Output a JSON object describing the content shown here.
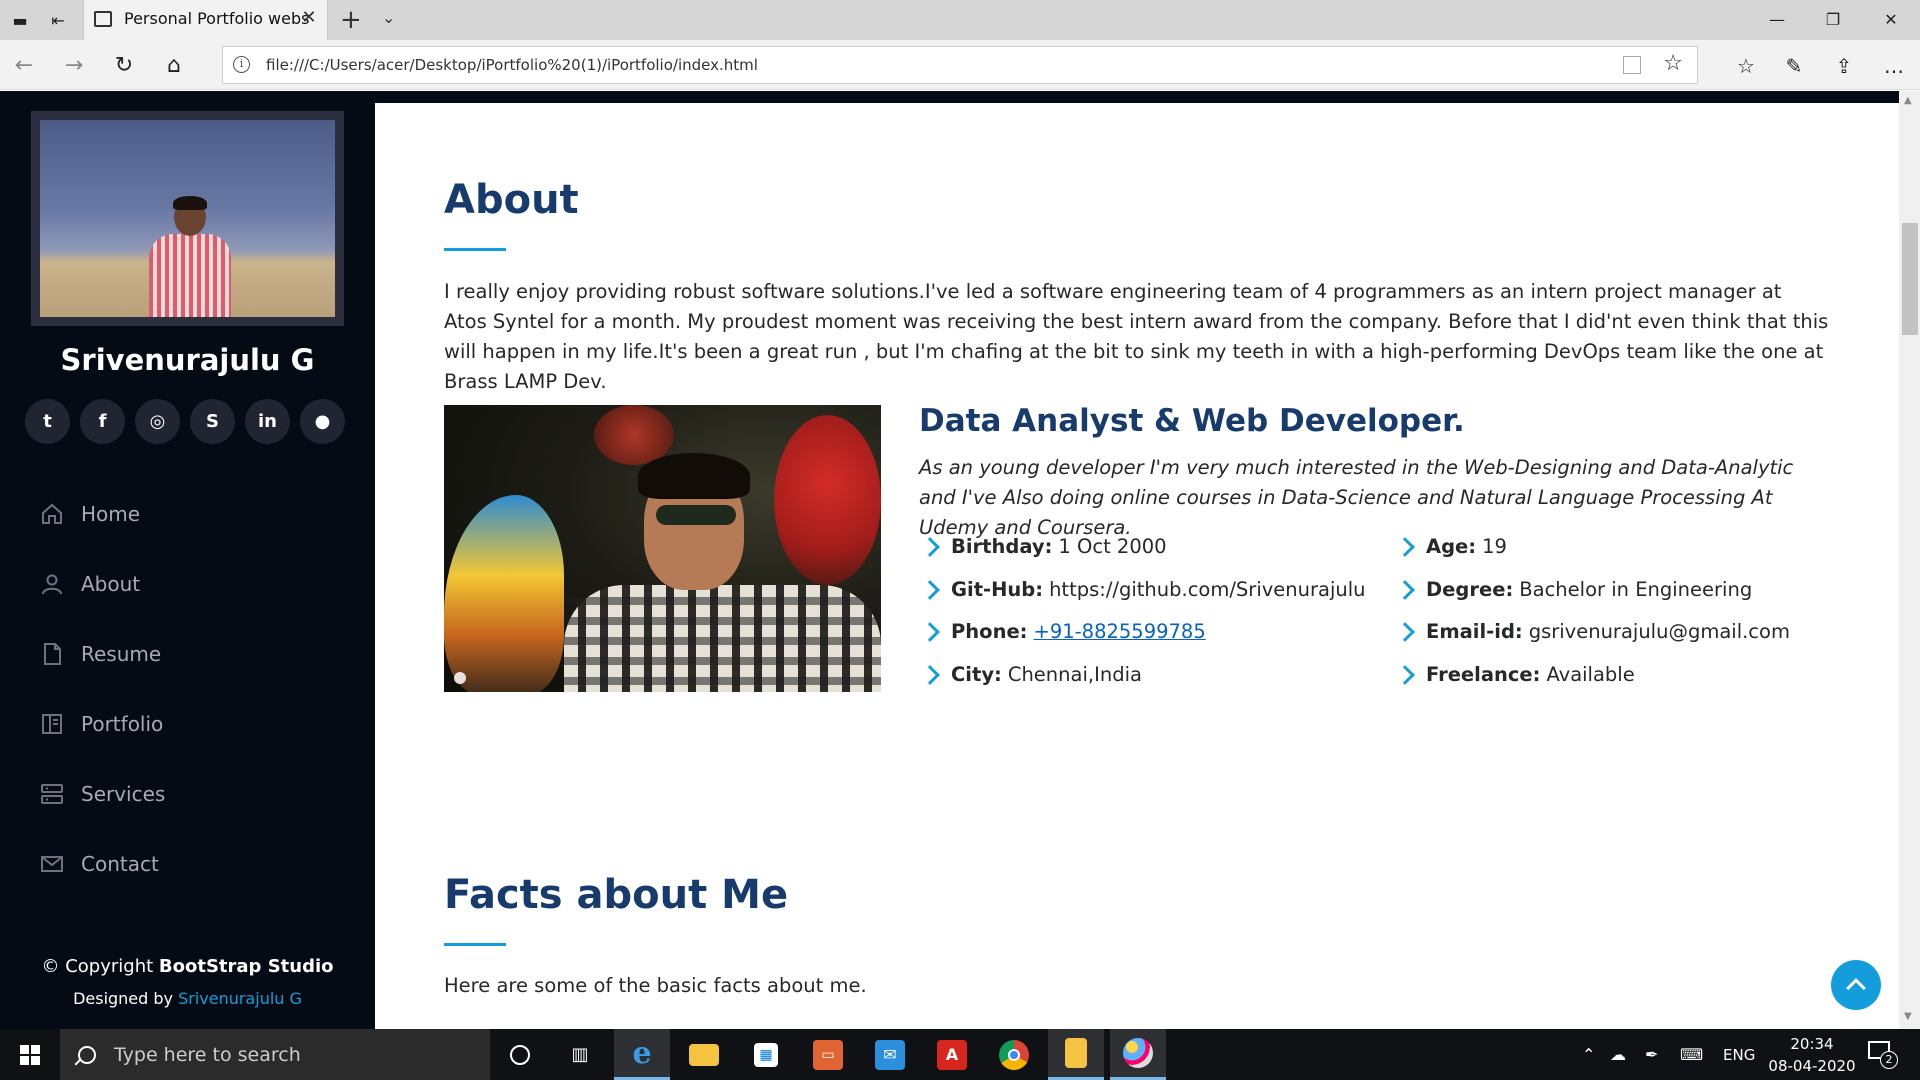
{
  "browser": {
    "tab_title": "Personal Portfolio webs",
    "url": "file:///C:/Users/acer/Desktop/iPortfolio%20(1)/iPortfolio/index.html"
  },
  "sidebar": {
    "name": "Srivenurajulu G",
    "socials": [
      {
        "icon": "twitter-icon",
        "glyph": "t"
      },
      {
        "icon": "facebook-icon",
        "glyph": "f"
      },
      {
        "icon": "instagram-icon",
        "glyph": "◎"
      },
      {
        "icon": "skype-icon",
        "glyph": "S"
      },
      {
        "icon": "linkedin-icon",
        "glyph": "in"
      },
      {
        "icon": "github-icon",
        "glyph": "●"
      }
    ],
    "menu": [
      {
        "label": "Home",
        "icon": "home-icon"
      },
      {
        "label": "About",
        "icon": "user-icon"
      },
      {
        "label": "Resume",
        "icon": "file-icon"
      },
      {
        "label": "Portfolio",
        "icon": "book-icon"
      },
      {
        "label": "Services",
        "icon": "server-icon"
      },
      {
        "label": "Contact",
        "icon": "envelope-icon"
      }
    ],
    "footer": {
      "copyright_prefix": "© Copyright",
      "copyright_brand": "BootStrap Studio",
      "designed_prefix": "Designed by",
      "designer": "Srivenurajulu G"
    }
  },
  "about": {
    "title": "About",
    "intro": "I really enjoy providing robust software solutions.I've led a software engineering team of 4 programmers as an intern project manager at Atos Syntel for a month. My proudest moment was receiving the best intern award from the company. Before that I did'nt even think that this will happen in my life.It's been a great run , but I'm chafing at the bit to sink my teeth in with a high-performing DevOps team like the one at Brass LAMP Dev.",
    "role": "Data Analyst & Web Developer.",
    "role_desc": "As an young developer I'm very much interested in the Web-Designing and Data-Analytic and I've Also doing online courses in Data-Science and Natural Language Processing At Udemy and Coursera.",
    "info_left": [
      {
        "label": "Birthday:",
        "value": "1 Oct 2000"
      },
      {
        "label": "Git-Hub:",
        "value": "https://github.com/Srivenurajulu"
      },
      {
        "label": "Phone:",
        "value": "+91-8825599785"
      },
      {
        "label": "City:",
        "value": "Chennai,India"
      }
    ],
    "info_right": [
      {
        "label": "Age:",
        "value": "19"
      },
      {
        "label": "Degree:",
        "value": "Bachelor in Engineering"
      },
      {
        "label": "Email-id:",
        "value": "gsrivenurajulu@gmail.com"
      },
      {
        "label": "Freelance:",
        "value": "Available"
      }
    ]
  },
  "facts": {
    "title": "Facts about Me",
    "intro": "Here are some of the basic facts about me."
  },
  "taskbar": {
    "search_placeholder": "Type here to search",
    "language": "ENG",
    "time": "20:34",
    "date": "08-04-2020",
    "notification_count": "2"
  },
  "colors": {
    "sidebar_bg": "#040b14",
    "heading": "#173b6c",
    "accent": "#149ddd"
  }
}
